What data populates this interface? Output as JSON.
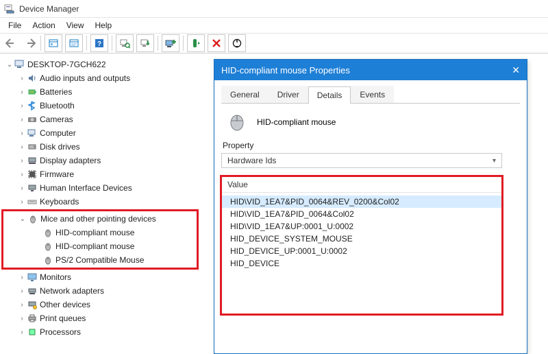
{
  "window": {
    "title": "Device Manager"
  },
  "menu": {
    "file": "File",
    "action": "Action",
    "view": "View",
    "help": "Help"
  },
  "tree": {
    "root": "DESKTOP-7GCH622",
    "nodes": [
      {
        "label": "Audio inputs and outputs"
      },
      {
        "label": "Batteries"
      },
      {
        "label": "Bluetooth"
      },
      {
        "label": "Cameras"
      },
      {
        "label": "Computer"
      },
      {
        "label": "Disk drives"
      },
      {
        "label": "Display adapters"
      },
      {
        "label": "Firmware"
      },
      {
        "label": "Human Interface Devices"
      },
      {
        "label": "Keyboards"
      },
      {
        "label": "Mice and other pointing devices"
      },
      {
        "label": "Monitors"
      },
      {
        "label": "Network adapters"
      },
      {
        "label": "Other devices"
      },
      {
        "label": "Print queues"
      },
      {
        "label": "Processors"
      }
    ],
    "mice_children": [
      {
        "label": "HID-compliant mouse"
      },
      {
        "label": "HID-compliant mouse"
      },
      {
        "label": "PS/2 Compatible Mouse"
      }
    ]
  },
  "dialog": {
    "title": "HID-compliant mouse Properties",
    "tabs": {
      "general": "General",
      "driver": "Driver",
      "details": "Details",
      "events": "Events"
    },
    "device_name": "HID-compliant mouse",
    "property_label": "Property",
    "property_value": "Hardware Ids",
    "value_label": "Value",
    "values": [
      "HID\\VID_1EA7&PID_0064&REV_0200&Col02",
      "HID\\VID_1EA7&PID_0064&Col02",
      "HID\\VID_1EA7&UP:0001_U:0002",
      "HID_DEVICE_SYSTEM_MOUSE",
      "HID_DEVICE_UP:0001_U:0002",
      "HID_DEVICE"
    ]
  },
  "colors": {
    "accent": "#1e7fd6",
    "highlight": "#e01b24"
  }
}
